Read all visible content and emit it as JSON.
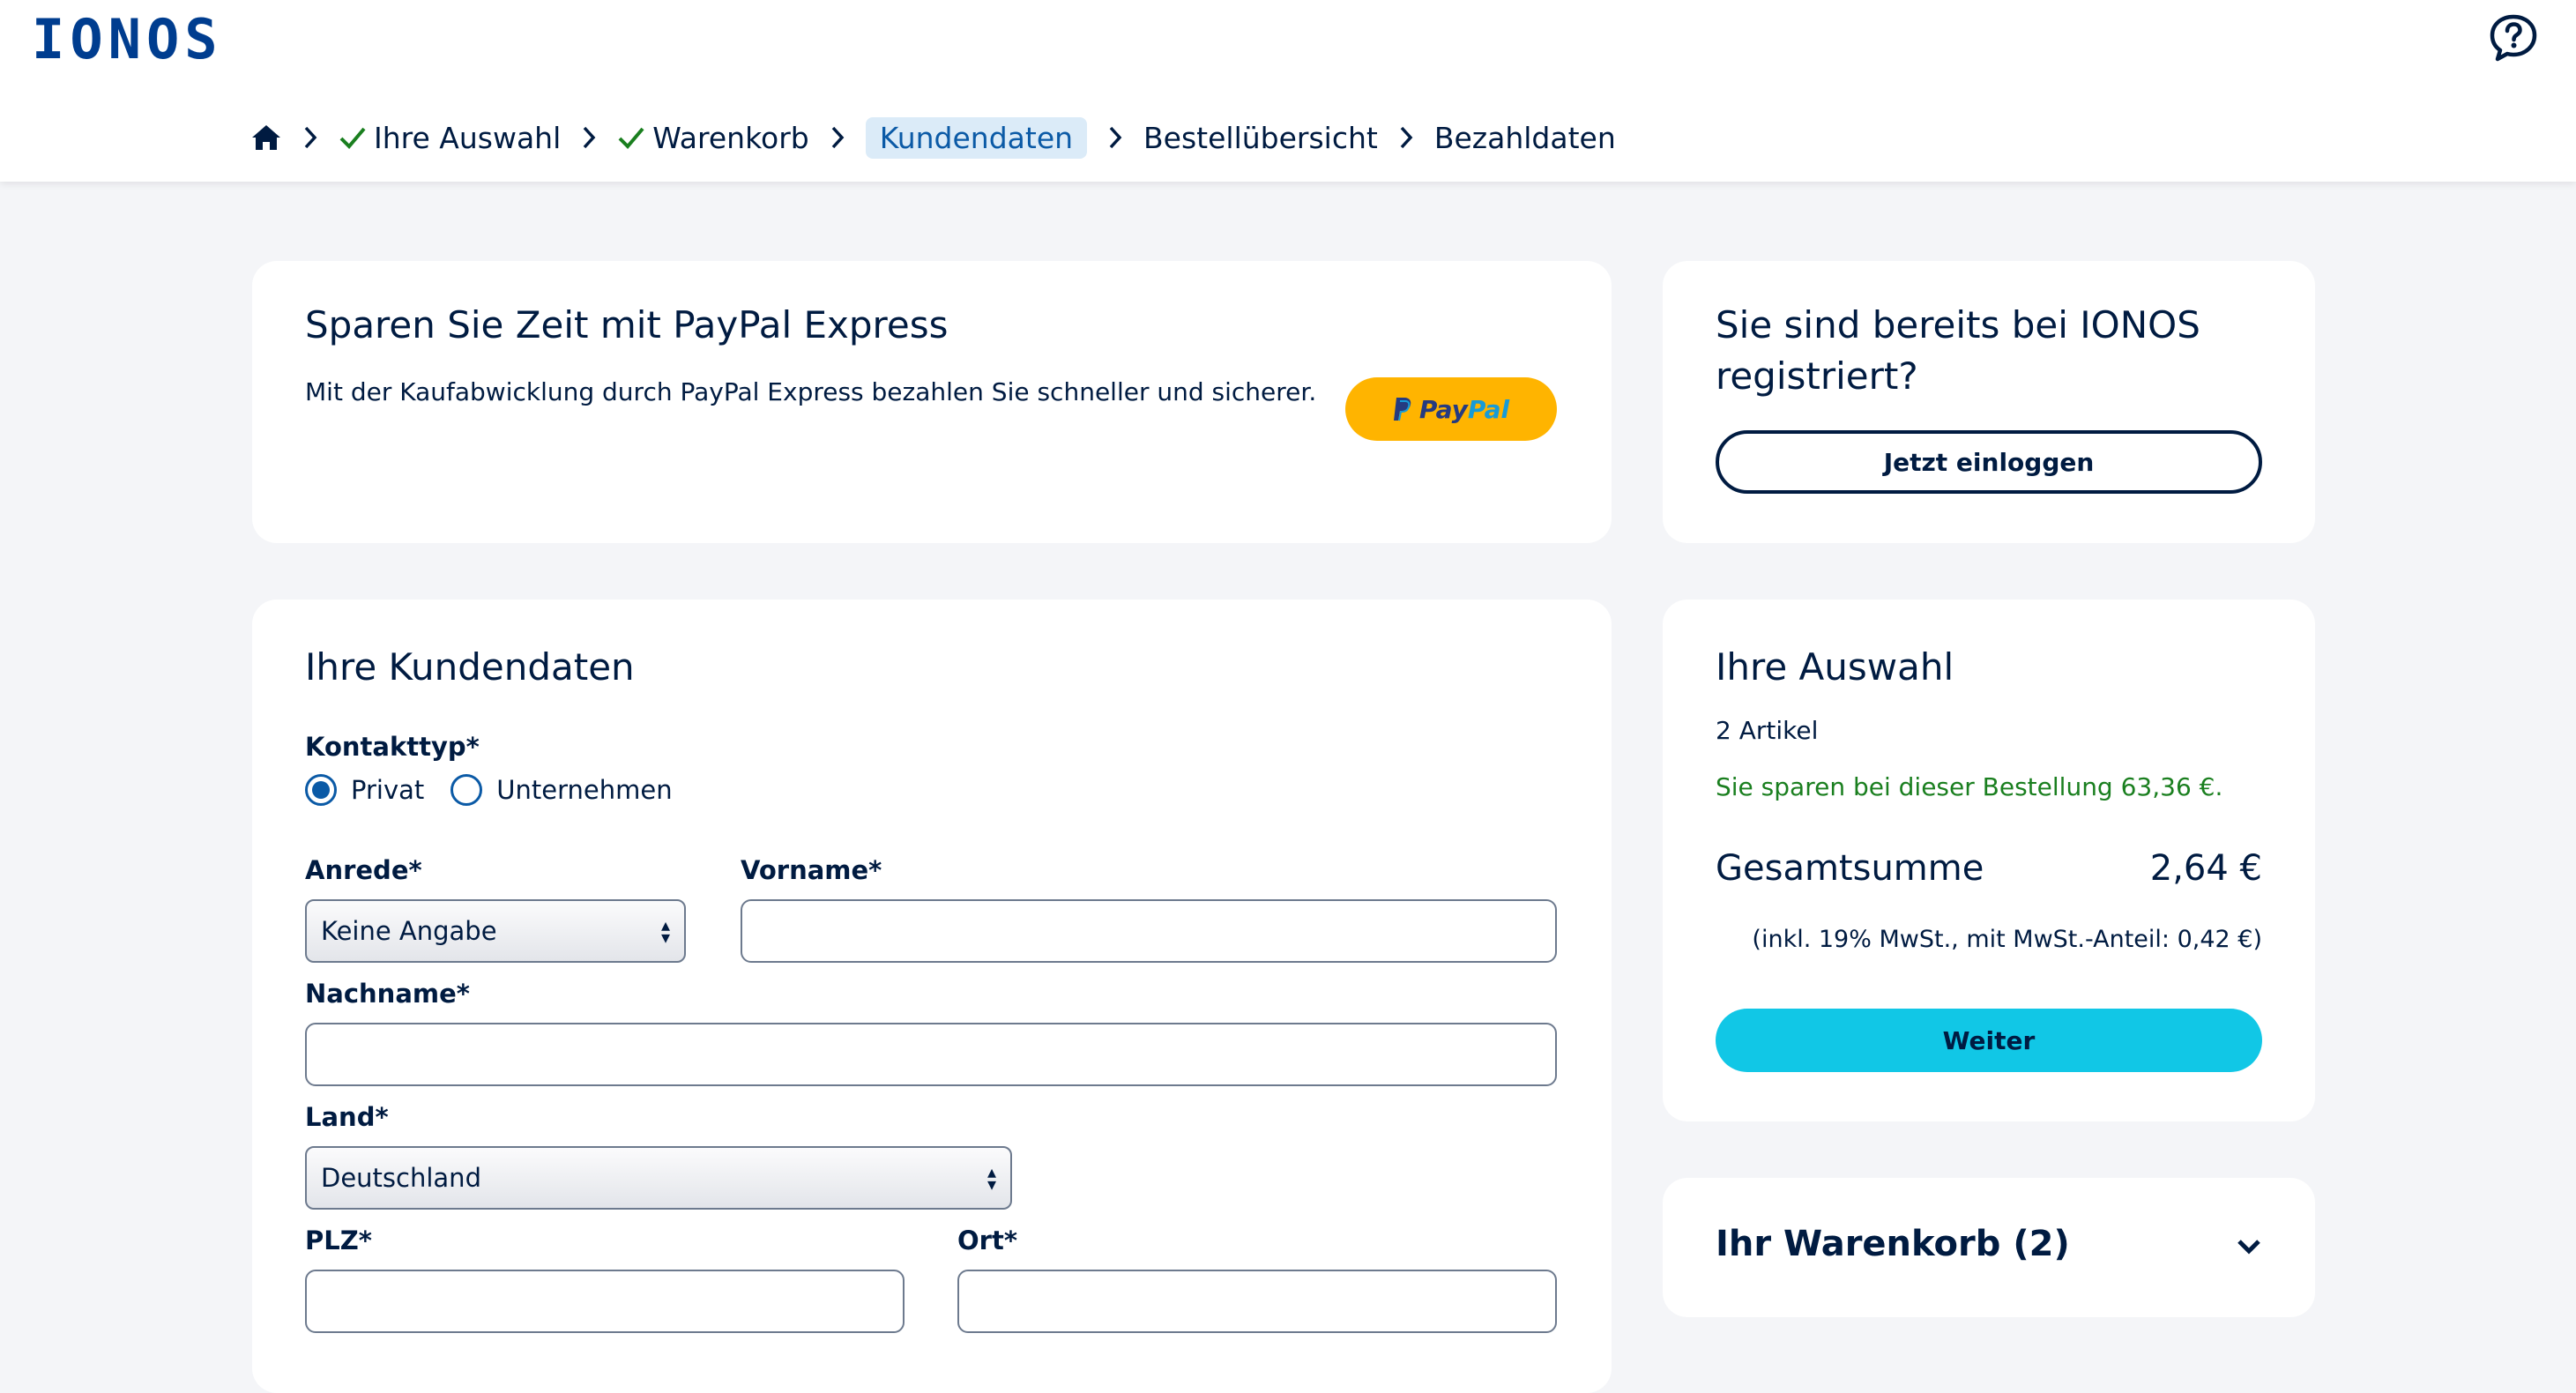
{
  "brand": {
    "logo": "IONOS",
    "primary": "#003d8f",
    "accent": "#11c7e6",
    "paypal": "#ffb400",
    "success": "#1a7f1f"
  },
  "header": {
    "help_icon": "help-chat-icon",
    "breadcrumb": {
      "home_icon": "home-icon",
      "steps": [
        {
          "label": "Ihre Auswahl",
          "state": "done"
        },
        {
          "label": "Warenkorb",
          "state": "done"
        },
        {
          "label": "Kundendaten",
          "state": "active"
        },
        {
          "label": "Bestellübersicht",
          "state": "pending"
        },
        {
          "label": "Bezahldaten",
          "state": "pending"
        }
      ]
    }
  },
  "paypal": {
    "title": "Sparen Sie Zeit mit PayPal Express",
    "text": "Mit der Kaufabwicklung durch PayPal Express bezahlen Sie schneller und sicherer.",
    "button_pay": "Pay",
    "button_pal": "Pal"
  },
  "login": {
    "title_line1": "Sie sind bereits bei IONOS",
    "title_line2": "registriert?",
    "button": "Jetzt einloggen"
  },
  "form": {
    "title": "Ihre Kundendaten",
    "contact_type_label": "Kontakttyp*",
    "contact_options": [
      {
        "label": "Privat",
        "selected": true
      },
      {
        "label": "Unternehmen",
        "selected": false
      }
    ],
    "salutation_label": "Anrede*",
    "salutation_value": "Keine Angabe",
    "firstname_label": "Vorname*",
    "firstname_value": "",
    "lastname_label": "Nachname*",
    "lastname_value": "",
    "country_label": "Land*",
    "country_value": "Deutschland",
    "zip_label": "PLZ*",
    "zip_value": "",
    "city_label": "Ort*",
    "city_value": ""
  },
  "summary": {
    "title": "Ihre Auswahl",
    "items": "2 Artikel",
    "saving": "Sie sparen bei dieser Bestellung 63,36 €.",
    "total_label": "Gesamtsumme",
    "total_value": "2,64 €",
    "vat": "(inkl. 19% MwSt., mit MwSt.-Anteil: 0,42 €)",
    "button": "Weiter"
  },
  "cart": {
    "title": "Ihr Warenkorb (2)"
  }
}
